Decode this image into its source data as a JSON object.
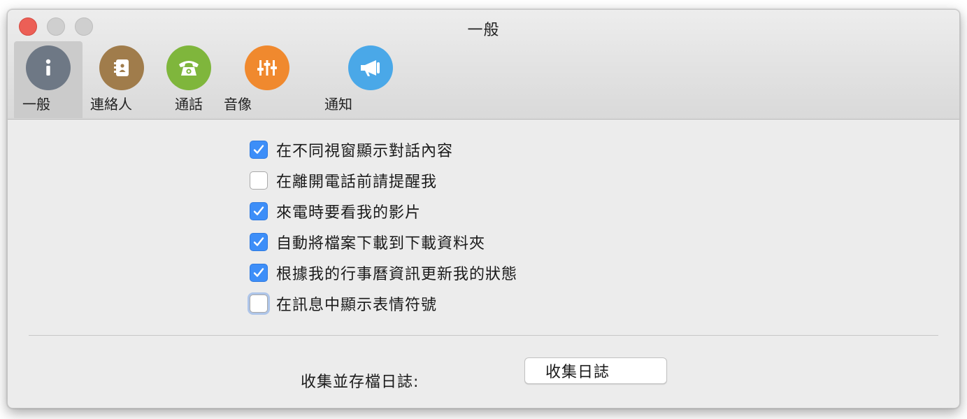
{
  "window": {
    "title": "一般"
  },
  "tabs": [
    {
      "label": "一般",
      "icon": "info-icon",
      "color": "#6e7885",
      "active": true
    },
    {
      "label": "連絡人",
      "icon": "contacts-book-icon",
      "color": "#a07c4b",
      "active": false
    },
    {
      "label": "通話",
      "icon": "phone-icon",
      "color": "#7fb63c",
      "active": false
    },
    {
      "label": "音像",
      "icon": "sliders-icon",
      "color": "#f0892e",
      "active": false
    },
    {
      "label": "通知",
      "icon": "megaphone-icon",
      "color": "#4aa8e8",
      "active": false
    }
  ],
  "options": [
    {
      "label": "在不同視窗顯示對話內容",
      "checked": true
    },
    {
      "label": "在離開電話前請提醒我",
      "checked": false
    },
    {
      "label": "來電時要看我的影片",
      "checked": true
    },
    {
      "label": "自動將檔案下載到下載資料夾",
      "checked": true
    },
    {
      "label": "根據我的行事曆資訊更新我的狀態",
      "checked": true
    },
    {
      "label": "在訊息中顯示表情符號",
      "checked": false
    }
  ],
  "logs": {
    "label": "收集並存檔日誌:",
    "button": "收集日誌"
  },
  "colors": {
    "accent": "#3d8ef8",
    "close": "#ec5f56"
  }
}
